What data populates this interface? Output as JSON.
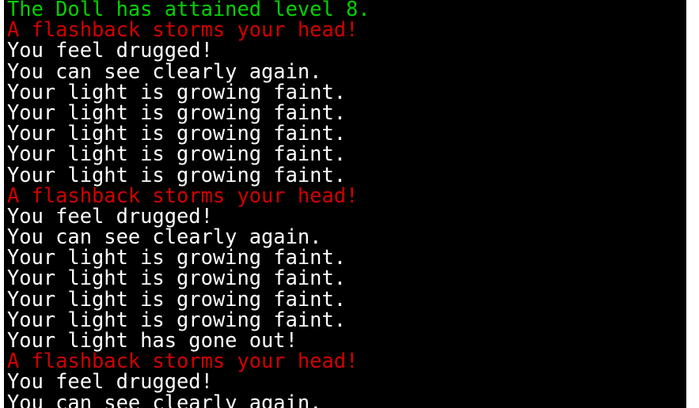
{
  "colors": {
    "background": "#000000",
    "green": "#00d200",
    "red": "#d20000",
    "white": "#ffffff"
  },
  "messages": [
    {
      "text": "The Doll has attained level 8.",
      "color": "green"
    },
    {
      "text": "A flashback storms your head!",
      "color": "red"
    },
    {
      "text": "You feel drugged!",
      "color": "white"
    },
    {
      "text": "You can see clearly again.",
      "color": "white"
    },
    {
      "text": "Your light is growing faint.",
      "color": "white"
    },
    {
      "text": "Your light is growing faint.",
      "color": "white"
    },
    {
      "text": "Your light is growing faint.",
      "color": "white"
    },
    {
      "text": "Your light is growing faint.",
      "color": "white"
    },
    {
      "text": "Your light is growing faint.",
      "color": "white"
    },
    {
      "text": "A flashback storms your head!",
      "color": "red"
    },
    {
      "text": "You feel drugged!",
      "color": "white"
    },
    {
      "text": "You can see clearly again.",
      "color": "white"
    },
    {
      "text": "Your light is growing faint.",
      "color": "white"
    },
    {
      "text": "Your light is growing faint.",
      "color": "white"
    },
    {
      "text": "Your light is growing faint.",
      "color": "white"
    },
    {
      "text": "Your light is growing faint.",
      "color": "white"
    },
    {
      "text": "Your light has gone out!",
      "color": "white"
    },
    {
      "text": "A flashback storms your head!",
      "color": "red"
    },
    {
      "text": "You feel drugged!",
      "color": "white"
    },
    {
      "text": "You can see clearly again.",
      "color": "white"
    }
  ]
}
